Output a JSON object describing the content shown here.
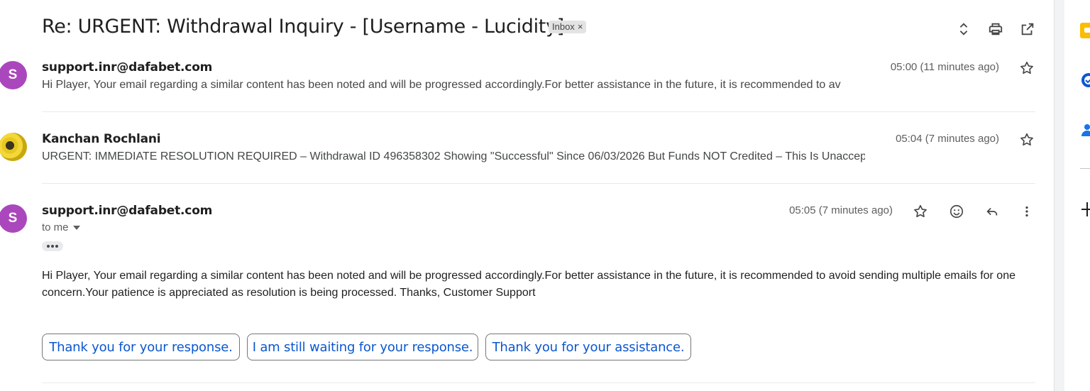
{
  "thread": {
    "subject": "Re: URGENT: Withdrawal Inquiry - [Username - Lucidity] -",
    "label": "Inbox",
    "label_remove": "×"
  },
  "toolbar": {
    "icons": [
      "expand-collapse-icon",
      "print-icon",
      "open-in-new-window-icon"
    ]
  },
  "messages": [
    {
      "avatar_letter": "S",
      "sender": "support.inr@dafabet.com",
      "time": "05:00 (11 minutes ago)",
      "snippet": "Hi Player, Your email regarding a similar content has been noted and will be progressed accordingly.For better assistance in the future, it is recommended to av"
    },
    {
      "avatar_letter": "",
      "sender": "Kanchan Rochlani",
      "time": "05:04 (7 minutes ago)",
      "snippet": "URGENT: IMMEDIATE RESOLUTION REQUIRED – Withdrawal ID 496358302 Showing \"Successful\" Since 06/03/2026 But Funds NOT Credited – This Is Unacceptable Dear Dafabet"
    },
    {
      "avatar_letter": "S",
      "sender": "support.inr@dafabet.com",
      "time": "05:05 (7 minutes ago)",
      "recipient": "to me",
      "body": "Hi Player, Your email regarding a similar content has been noted and will be progressed accordingly.For better assistance in the future, it is recommended to avoid sending multiple emails for one concern.Your patience is appreciated as resolution is being processed. Thanks, Customer Support"
    }
  ],
  "smart_replies": [
    "Thank you for your response.",
    "I am still waiting for your response.",
    "Thank you for your assistance."
  ],
  "colors": {
    "avatar": "#ab47bc",
    "link_blue": "#0b57d0",
    "label_bg": "#e3e3e3"
  }
}
